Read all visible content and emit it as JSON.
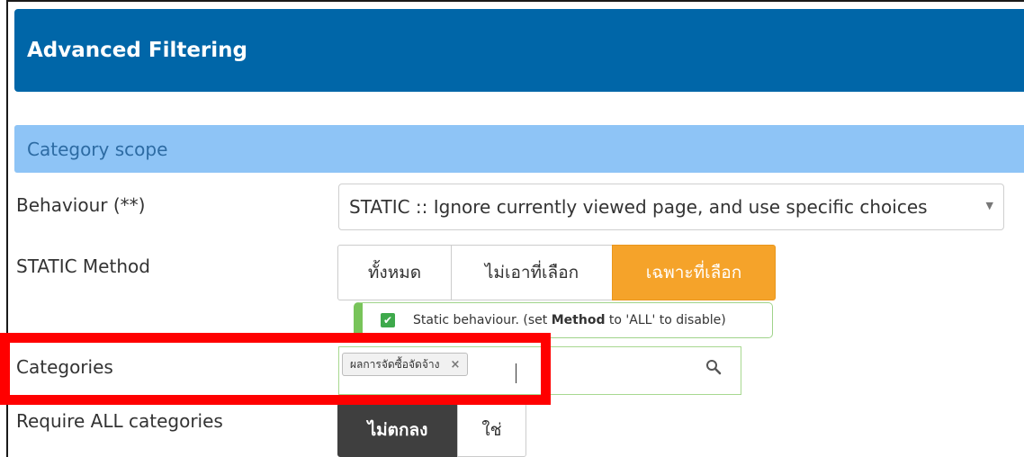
{
  "header": {
    "title": "Advanced Filtering"
  },
  "section": {
    "title": "Category scope"
  },
  "behaviour": {
    "label": "Behaviour (**)",
    "selected": "STATIC :: Ignore currently viewed page, and use specific choices"
  },
  "static_method": {
    "label": "STATIC Method",
    "options": [
      "ทั้งหมด",
      "ไม่เอาที่เลือก",
      "เฉพาะที่เลือก"
    ],
    "active_index": 2
  },
  "notice": {
    "text_before": "Static behaviour. (set ",
    "bold": "Method",
    "text_after": " to 'ALL' to disable)"
  },
  "categories": {
    "label": "Categories",
    "tags": [
      {
        "label": "ผลการจัดซื้อจัดจ้าง",
        "remove": "×"
      }
    ]
  },
  "require_all": {
    "label": "Require ALL categories",
    "options": [
      "ไม่ตกลง",
      "ใช่"
    ],
    "active_index": 0
  },
  "colors": {
    "header_bg": "#0066a8",
    "section_bg": "#8ec4f6",
    "active_orange": "#f5a32a",
    "active_dark": "#3f3f3f",
    "highlight": "#ff0000"
  }
}
